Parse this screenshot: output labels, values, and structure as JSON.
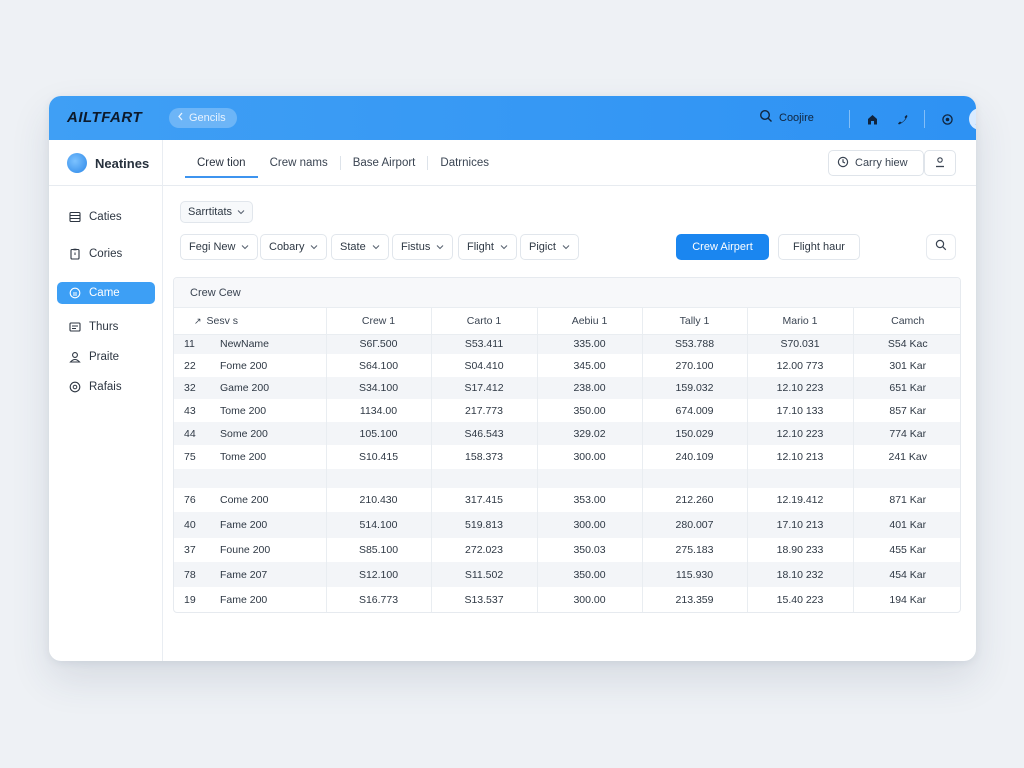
{
  "app": {
    "logo": "AILTFART",
    "back_label": "Gencils",
    "search_label": "Coojire"
  },
  "subheader": {
    "brand": "Neatines",
    "tabs": [
      {
        "label": "Crew tion",
        "active": true
      },
      {
        "label": "Crew nams",
        "active": false
      },
      {
        "label": "Base Airport",
        "active": false
      },
      {
        "label": "Datrnices",
        "active": false
      }
    ],
    "right_button": "Carry hiew"
  },
  "sidebar": {
    "items": [
      {
        "label": "Caties",
        "icon": "list-icon",
        "active": false
      },
      {
        "label": "Cories",
        "icon": "clipboard-icon",
        "active": false
      },
      {
        "label": "Came",
        "icon": "circle-icon",
        "active": true
      },
      {
        "label": "Thurs",
        "icon": "card-icon",
        "active": false
      },
      {
        "label": "Praite",
        "icon": "user-icon",
        "active": false
      },
      {
        "label": "Rafais",
        "icon": "settings-icon",
        "active": false
      }
    ]
  },
  "toolbar": {
    "chip": "Sarrtitats",
    "filters": [
      "Fegi New",
      "Cobary",
      "State",
      "Fistus",
      "Flight",
      "Pigict"
    ],
    "primary_button": "Crew Airpert",
    "secondary_button": "Flight haur"
  },
  "table": {
    "title": "Crew Cew",
    "columns": [
      "Sesv s",
      "Crew 1",
      "Carto 1",
      "Aebiu 1",
      "Tally 1",
      "Mario 1",
      "Camch"
    ],
    "rows": [
      {
        "num": "11",
        "name": "NewName",
        "c1": "S6Γ.500",
        "c2": "S53.411",
        "c3": "335.00",
        "c4": "S53.788",
        "c5": "S70.031",
        "c6": "S54 Kac",
        "striped": true
      },
      {
        "num": "22",
        "name": "Fome 200",
        "c1": "S64.100",
        "c2": "S04.410",
        "c3": "345.00",
        "c4": "270.100",
        "c5": "12.00 773",
        "c6": "301 Kar",
        "striped": false
      },
      {
        "num": "32",
        "name": "Game 200",
        "c1": "S34.100",
        "c2": "S17.412",
        "c3": "238.00",
        "c4": "159.032",
        "c5": "12.10 223",
        "c6": "651 Kar",
        "striped": true
      },
      {
        "num": "43",
        "name": "Tome 200",
        "c1": "1134.00",
        "c2": "217.773",
        "c3": "350.00",
        "c4": "674.009",
        "c5": "17.10 133",
        "c6": "857 Kar",
        "striped": false
      },
      {
        "num": "44",
        "name": "Some 200",
        "c1": "105.100",
        "c2": "S46.543",
        "c3": "329.02",
        "c4": "150.029",
        "c5": "12.10 223",
        "c6": "774 Kar",
        "striped": true
      },
      {
        "num": "75",
        "name": "Tome 200",
        "c1": "S10.415",
        "c2": "158.373",
        "c3": "300.00",
        "c4": "240.109",
        "c5": "12.10 213",
        "c6": "241 Kav",
        "striped": false
      },
      {
        "num": "",
        "name": "",
        "c1": "",
        "c2": "",
        "c3": "",
        "c4": "",
        "c5": "",
        "c6": "",
        "striped": true
      },
      {
        "num": "76",
        "name": "Come 200",
        "c1": "210.430",
        "c2": "317.415",
        "c3": "353.00",
        "c4": "212.260",
        "c5": "12.19.412",
        "c6": "871 Kar",
        "striped": false
      },
      {
        "num": "40",
        "name": "Fame 200",
        "c1": "514.100",
        "c2": "519.813",
        "c3": "300.00",
        "c4": "280.007",
        "c5": "17.10 213",
        "c6": "401 Kar",
        "striped": true
      },
      {
        "num": "37",
        "name": "Foune 200",
        "c1": "S85.100",
        "c2": "272.023",
        "c3": "350.03",
        "c4": "275.183",
        "c5": "18.90 233",
        "c6": "455 Kar",
        "striped": false
      },
      {
        "num": "78",
        "name": "Fame 207",
        "c1": "S12.100",
        "c2": "S11.502",
        "c3": "350.00",
        "c4": "115.930",
        "c5": "18.10 232",
        "c6": "454 Kar",
        "striped": true
      },
      {
        "num": "19",
        "name": "Fame 200",
        "c1": "S16.773",
        "c2": "S13.537",
        "c3": "300.00",
        "c4": "213.359",
        "c5": "15.40 223",
        "c6": "194 Kar",
        "striped": false
      }
    ]
  }
}
